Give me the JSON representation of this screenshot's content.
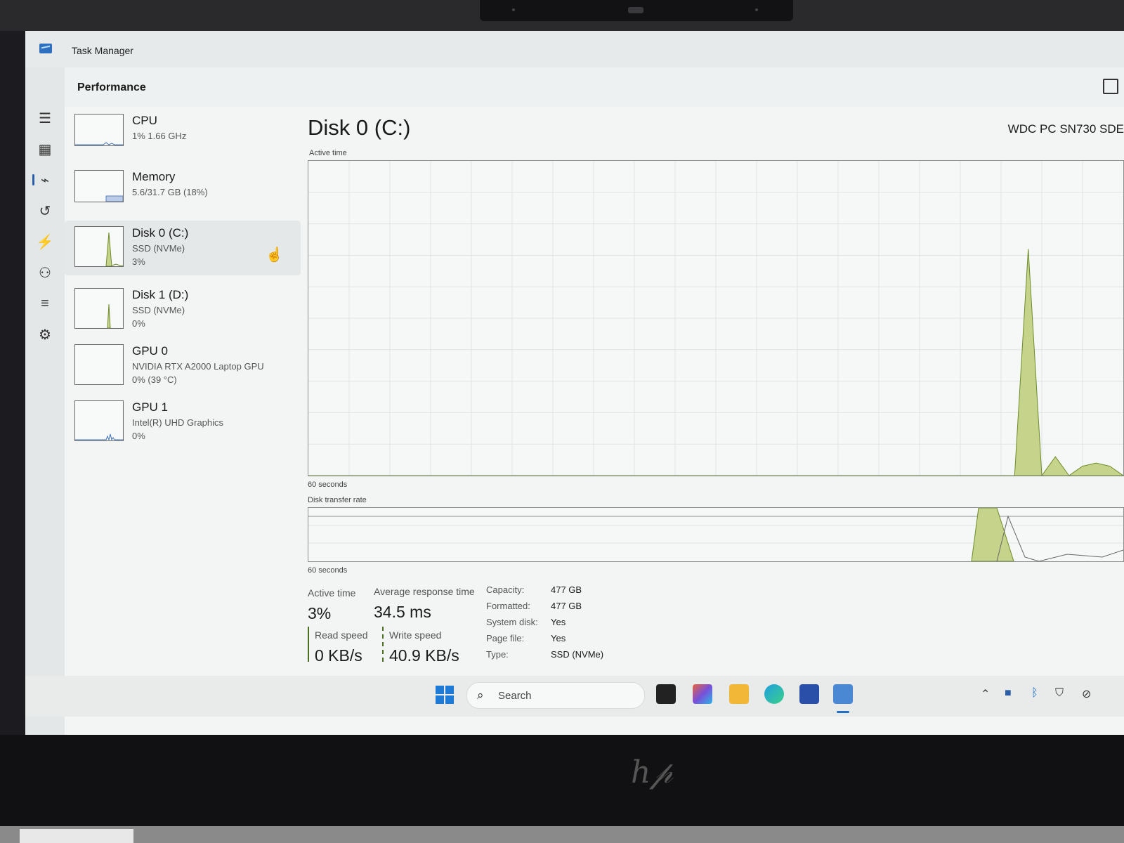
{
  "window": {
    "title": "Task Manager"
  },
  "page": {
    "title": "Performance"
  },
  "devices": [
    {
      "name": "CPU",
      "line1": "1% 1.66 GHz",
      "line2": ""
    },
    {
      "name": "Memory",
      "line1": "5.6/31.7 GB (18%)",
      "line2": ""
    },
    {
      "name": "Disk 0 (C:)",
      "line1": "SSD (NVMe)",
      "line2": "3%"
    },
    {
      "name": "Disk 1 (D:)",
      "line1": "SSD (NVMe)",
      "line2": "0%"
    },
    {
      "name": "GPU 0",
      "line1": "NVIDIA RTX A2000 Laptop GPU",
      "line2": "0% (39 °C)"
    },
    {
      "name": "GPU 1",
      "line1": "Intel(R) UHD Graphics",
      "line2": "0%"
    }
  ],
  "disk": {
    "title": "Disk 0 (C:)",
    "model": "WDC PC SN730 SDE",
    "active_time_label": "Active time",
    "transfer_rate_label": "Disk transfer rate",
    "axis_60s": "60 seconds",
    "active_time_pct_series": [
      0,
      0,
      0,
      0,
      0,
      0,
      0,
      0,
      0,
      0,
      0,
      0,
      0,
      0,
      0,
      0,
      0,
      0,
      0,
      0,
      0,
      0,
      0,
      0,
      0,
      0,
      0,
      0,
      0,
      0,
      0,
      0,
      0,
      0,
      0,
      0,
      0,
      0,
      0,
      0,
      0,
      0,
      0,
      0,
      0,
      0,
      0,
      0,
      0,
      0,
      0,
      0,
      0,
      72,
      0,
      6,
      0,
      3,
      4,
      3,
      0
    ],
    "stats": {
      "active_time": {
        "label": "Active time",
        "value": "3%"
      },
      "avg_response": {
        "label": "Average response time",
        "value": "34.5 ms"
      },
      "read_speed": {
        "label": "Read speed",
        "value": "0 KB/s"
      },
      "write_speed": {
        "label": "Write speed",
        "value": "40.9 KB/s"
      }
    },
    "properties": [
      {
        "label": "Capacity:",
        "value": "477 GB"
      },
      {
        "label": "Formatted:",
        "value": "477 GB"
      },
      {
        "label": "System disk:",
        "value": "Yes"
      },
      {
        "label": "Page file:",
        "value": "Yes"
      },
      {
        "label": "Type:",
        "value": "SSD (NVMe)"
      }
    ]
  },
  "taskbar": {
    "search_placeholder": "Search"
  },
  "colors": {
    "graph_fill": "#c5d48a",
    "graph_line": "#6f8a2a",
    "grid": "#dfe4e4",
    "accent": "#1f7ad6"
  }
}
